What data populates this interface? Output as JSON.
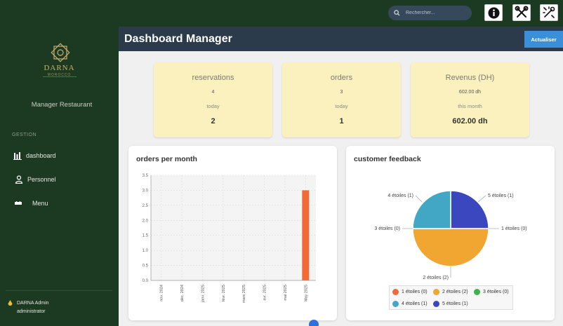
{
  "search": {
    "placeholder": "Rechercher..."
  },
  "toolbar": {
    "info_icon": "info-icon",
    "tools_icon": "tools-icon",
    "wrench_icon": "wrench-icon"
  },
  "sidebar": {
    "brand": "DARNA",
    "brand_sub": "MOROCCO",
    "role": "Manager Restaurant",
    "section": "GESTION",
    "items": [
      {
        "label": "dashboard",
        "icon": "chart-bar-icon"
      },
      {
        "label": "Personnel",
        "icon": "user-icon"
      },
      {
        "label": "Menu",
        "icon": "menu-icon"
      }
    ],
    "user": {
      "name": "DARNA Admin",
      "role": "administrator"
    }
  },
  "header": {
    "title": "Dashboard Manager",
    "refresh_label": "Actualiser"
  },
  "stats": [
    {
      "title": "reservations",
      "value1": "4",
      "period": "today",
      "value2": "2"
    },
    {
      "title": "orders",
      "value1": "3",
      "period": "today",
      "value2": "1"
    },
    {
      "title": "Revenus (DH)",
      "value1": "602.00 dh",
      "period": "this month",
      "value2": "602.00 dh"
    }
  ],
  "panels": {
    "orders_title": "orders per month",
    "feedback_title": "customer feedback"
  },
  "chart_data": [
    {
      "type": "bar",
      "title": "orders per month",
      "categories": [
        "nov. 2024",
        "déc. 2024",
        "janv. 2025",
        "févr. 2025",
        "mars 2025",
        "avr. 2025",
        "mai 2025",
        "May 2025"
      ],
      "values": [
        0,
        0,
        0,
        0,
        0,
        0,
        0,
        3
      ],
      "ylim": [
        0,
        3.5
      ],
      "yticks": [
        "0.0",
        "0.5",
        "1.0",
        "1.5",
        "2.0",
        "2.5",
        "3.0",
        "3.5"
      ],
      "grid": true,
      "color": "#f26a35"
    },
    {
      "type": "pie",
      "title": "customer feedback",
      "categories": [
        "1 étoiles",
        "2 étoiles",
        "3 étoiles",
        "4 étoiles",
        "5 étoiles"
      ],
      "values": [
        0,
        2,
        0,
        1,
        1
      ],
      "slice_labels": [
        "1 étoiles (0)",
        "2 étoiles (2)",
        "3 étoiles (0)",
        "4 étoiles (1)",
        "5 étoiles (1)"
      ],
      "colors": [
        "#ee6a3c",
        "#f0a631",
        "#3fb24a",
        "#42a7c4",
        "#3b47be"
      ],
      "legend": "bottom"
    }
  ]
}
